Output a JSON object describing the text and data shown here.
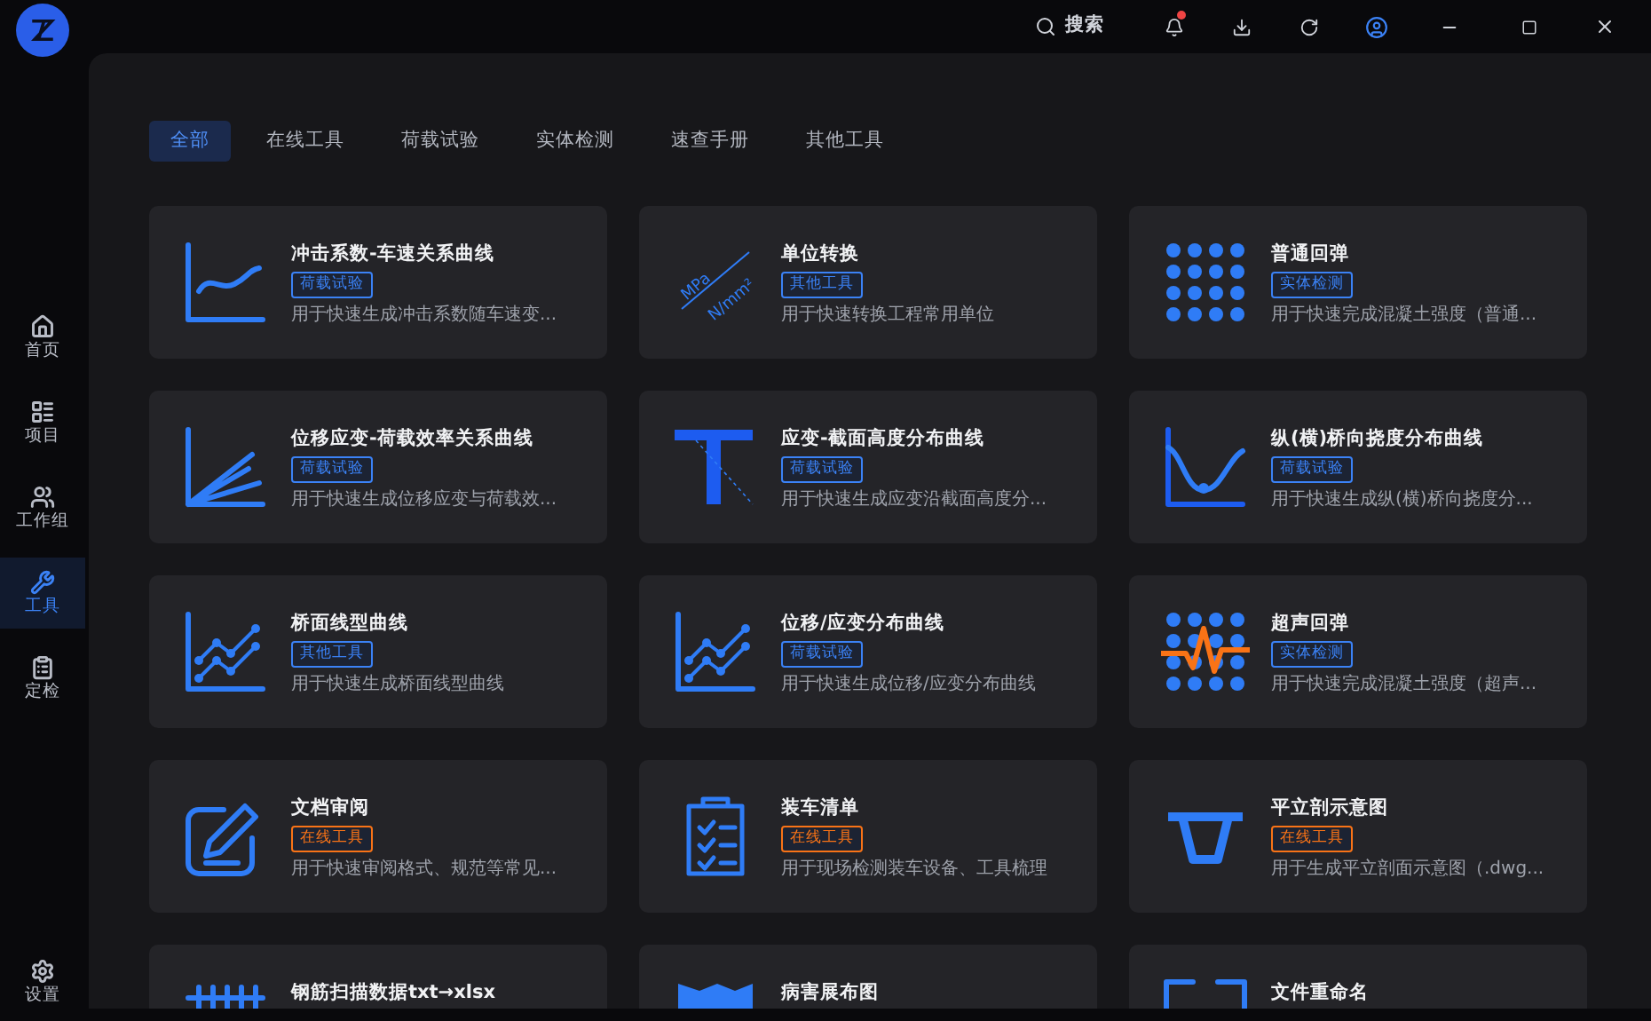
{
  "topbar": {
    "search_label": "搜索",
    "has_notification": true
  },
  "sidebar": {
    "items": [
      {
        "label": "首页",
        "selected": false
      },
      {
        "label": "项目",
        "selected": false
      },
      {
        "label": "工作组",
        "selected": false
      },
      {
        "label": "工具",
        "selected": true
      },
      {
        "label": "定检",
        "selected": false
      }
    ],
    "settings_label": "设置"
  },
  "tabs": [
    {
      "label": "全部",
      "selected": true
    },
    {
      "label": "在线工具",
      "selected": false
    },
    {
      "label": "荷载试验",
      "selected": false
    },
    {
      "label": "实体检测",
      "selected": false
    },
    {
      "label": "速查手册",
      "selected": false
    },
    {
      "label": "其他工具",
      "selected": false
    }
  ],
  "cards": [
    {
      "title": "冲击系数-车速关系曲线",
      "tag": {
        "label": "荷载试验",
        "color": "#3b82f6"
      },
      "description": "用于快速生成冲击系数随车速变..."
    },
    {
      "title": "单位转换",
      "icon_text": [
        "MPa",
        "N/mm²"
      ],
      "tag": {
        "label": "其他工具",
        "color": "#3b82f6"
      },
      "description": "用于快速转换工程常用单位"
    },
    {
      "title": "普通回弹",
      "tag": {
        "label": "实体检测",
        "color": "#3b82f6"
      },
      "description": "用于快速完成混凝土强度（普通..."
    },
    {
      "title": "位移应变-荷载效率关系曲线",
      "tag": {
        "label": "荷载试验",
        "color": "#3b82f6"
      },
      "description": "用于快速生成位移应变与荷载效..."
    },
    {
      "title": "应变-截面高度分布曲线",
      "tag": {
        "label": "荷载试验",
        "color": "#3b82f6"
      },
      "description": "用于快速生成应变沿截面高度分..."
    },
    {
      "title": "纵(横)桥向挠度分布曲线",
      "tag": {
        "label": "荷载试验",
        "color": "#3b82f6"
      },
      "description": "用于快速生成纵(横)桥向挠度分..."
    },
    {
      "title": "桥面线型曲线",
      "tag": {
        "label": "其他工具",
        "color": "#3b82f6"
      },
      "description": "用于快速生成桥面线型曲线"
    },
    {
      "title": "位移/应变分布曲线",
      "tag": {
        "label": "荷载试验",
        "color": "#3b82f6"
      },
      "description": "用于快速生成位移/应变分布曲线"
    },
    {
      "title": "超声回弹",
      "tag": {
        "label": "实体检测",
        "color": "#3b82f6"
      },
      "description": "用于快速完成混凝土强度（超声..."
    },
    {
      "title": "文档审阅",
      "tag": {
        "label": "在线工具",
        "color": "#f97316"
      },
      "description": "用于快速审阅格式、规范等常见..."
    },
    {
      "title": "装车清单",
      "tag": {
        "label": "在线工具",
        "color": "#f97316"
      },
      "description": "用于现场检测装车设备、工具梳理"
    },
    {
      "title": "平立剖示意图",
      "tag": {
        "label": "在线工具",
        "color": "#f97316"
      },
      "description": "用于生成平立剖面示意图（.dwg..."
    },
    {
      "title": "钢筋扫描数据txt→xlsx"
    },
    {
      "title": "病害展布图"
    },
    {
      "title": "文件重命名"
    }
  ]
}
